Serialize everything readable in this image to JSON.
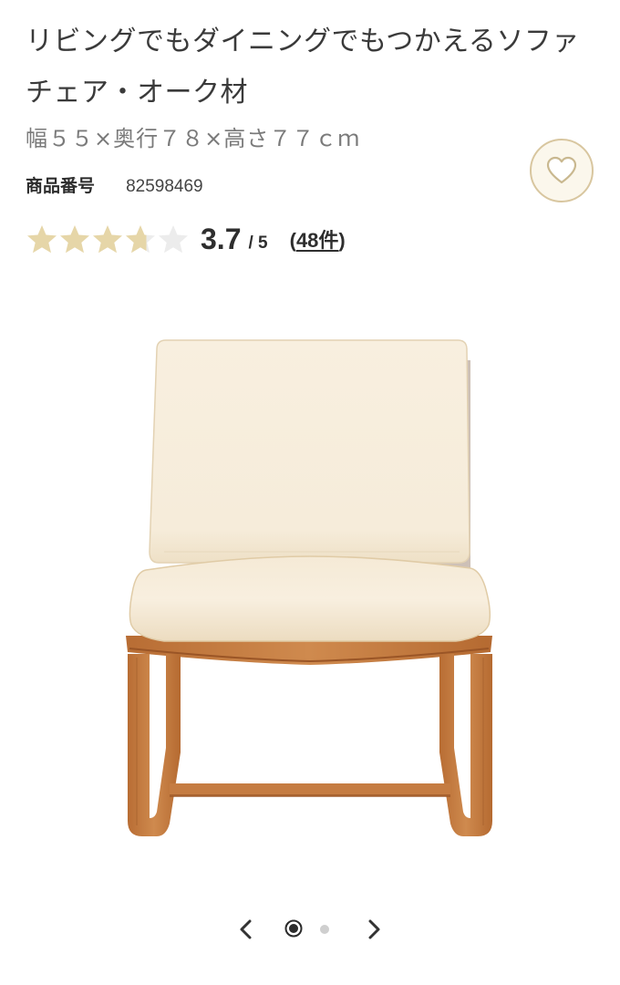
{
  "product": {
    "title": "リビングでもダイニングでもつかえるソファチェア・オーク材",
    "size": "幅５５×奥行７８×高さ７７ｃｍ",
    "number_label": "商品番号",
    "number_value": "82598469"
  },
  "favorite": {
    "icon": "heart-icon",
    "accent_color": "#d8c69f"
  },
  "rating": {
    "score": "3.7",
    "max_text": "/ 5",
    "value": 3.7,
    "max": 5,
    "review_count_open": "(",
    "review_count": "48件",
    "review_count_close": ")",
    "star_color": "#e6d6a8",
    "star_empty_color": "#ececec"
  },
  "gallery": {
    "image_subject": "sofa-chair-product-photo",
    "current_index": 1,
    "total": 2,
    "prev_icon": "chevron-left-icon",
    "next_icon": "chevron-right-icon"
  }
}
